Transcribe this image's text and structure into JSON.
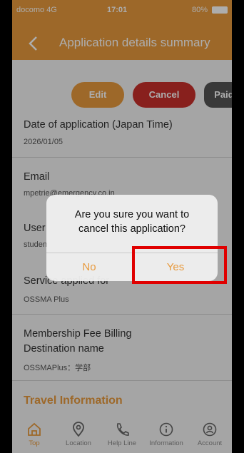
{
  "status_bar": {
    "carrier": "docomo  4G",
    "time": "17:01",
    "battery": "80%"
  },
  "header": {
    "title": "Application details summary"
  },
  "actions": {
    "edit": "Edit",
    "cancel": "Cancel",
    "paid": "Paid"
  },
  "fields": [
    {
      "label": "Date of application (Japan Time)",
      "value": "2026/01/05"
    },
    {
      "label": "Email",
      "value": "mpetrie@emergency.co.in"
    },
    {
      "label": "User",
      "value": "studen"
    },
    {
      "label": "Service applied for",
      "value": "OSSMA Plus"
    },
    {
      "label_line1": "Membership Fee Billing",
      "label_line2": "Destination name",
      "value": "OSSMAPlus：学部"
    }
  ],
  "section": {
    "travel_information": "Travel Information"
  },
  "tabs": [
    {
      "label": "Top",
      "icon": "home-icon"
    },
    {
      "label": "Location",
      "icon": "location-pin-icon"
    },
    {
      "label": "Help Line",
      "icon": "phone-icon"
    },
    {
      "label": "Information",
      "icon": "info-icon"
    },
    {
      "label": "Account",
      "icon": "account-icon"
    }
  ],
  "dialog": {
    "message_line1": "Are you sure you want to",
    "message_line2": "cancel this application?",
    "no": "No",
    "yes": "Yes"
  },
  "colors": {
    "accent": "#e89a3d",
    "danger": "#c9302c",
    "highlight": "#e00000"
  }
}
